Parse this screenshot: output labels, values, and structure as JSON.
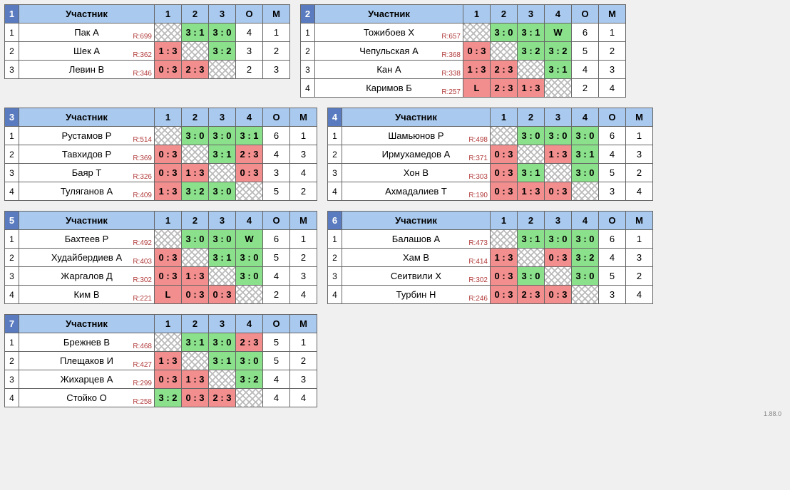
{
  "labels": {
    "participant": "Участник",
    "points": "О",
    "place": "М",
    "rating_prefix": "R:"
  },
  "version": "1.88.0",
  "groups": [
    {
      "number": 1,
      "name_width": 190,
      "rounds": 3,
      "players": [
        {
          "seed": 1,
          "name": "Пак А",
          "rating": 699,
          "results": [
            null,
            {
              "s": "3 : 1",
              "w": true
            },
            {
              "s": "3 : 0",
              "w": true
            }
          ],
          "pts": 4,
          "place": 1
        },
        {
          "seed": 2,
          "name": "Шек А",
          "rating": 362,
          "results": [
            {
              "s": "1 : 3",
              "w": false
            },
            null,
            {
              "s": "3 : 2",
              "w": true
            }
          ],
          "pts": 3,
          "place": 2
        },
        {
          "seed": 3,
          "name": "Левин В",
          "rating": 346,
          "results": [
            {
              "s": "0 : 3",
              "w": false
            },
            {
              "s": "2 : 3",
              "w": false
            },
            null
          ],
          "pts": 2,
          "place": 3
        }
      ]
    },
    {
      "number": 2,
      "name_width": 208,
      "rounds": 4,
      "players": [
        {
          "seed": 1,
          "name": "Тожибоев Х",
          "rating": 657,
          "results": [
            null,
            {
              "s": "3 : 0",
              "w": true
            },
            {
              "s": "3 : 1",
              "w": true
            },
            {
              "s": "W",
              "w": true
            }
          ],
          "pts": 6,
          "place": 1
        },
        {
          "seed": 2,
          "name": "Чепульская А",
          "rating": 368,
          "results": [
            {
              "s": "0 : 3",
              "w": false
            },
            null,
            {
              "s": "3 : 2",
              "w": true
            },
            {
              "s": "3 : 2",
              "w": true
            }
          ],
          "pts": 5,
          "place": 2
        },
        {
          "seed": 3,
          "name": "Кан А",
          "rating": 338,
          "results": [
            {
              "s": "1 : 3",
              "w": false
            },
            {
              "s": "2 : 3",
              "w": false
            },
            null,
            {
              "s": "3 : 1",
              "w": true
            }
          ],
          "pts": 4,
          "place": 3
        },
        {
          "seed": 4,
          "name": "Каримов Б",
          "rating": 257,
          "results": [
            {
              "s": "L",
              "w": false
            },
            {
              "s": "2 : 3",
              "w": false
            },
            {
              "s": "1 : 3",
              "w": false
            },
            null
          ],
          "pts": 2,
          "place": 4
        }
      ]
    },
    {
      "number": 3,
      "name_width": 190,
      "rounds": 4,
      "players": [
        {
          "seed": 1,
          "name": "Рустамов Р",
          "rating": 514,
          "results": [
            null,
            {
              "s": "3 : 0",
              "w": true
            },
            {
              "s": "3 : 0",
              "w": true
            },
            {
              "s": "3 : 1",
              "w": true
            }
          ],
          "pts": 6,
          "place": 1
        },
        {
          "seed": 2,
          "name": "Тавхидов Р",
          "rating": 369,
          "results": [
            {
              "s": "0 : 3",
              "w": false
            },
            null,
            {
              "s": "3 : 1",
              "w": true
            },
            {
              "s": "2 : 3",
              "w": false
            }
          ],
          "pts": 4,
          "place": 3
        },
        {
          "seed": 3,
          "name": "Баяр Т",
          "rating": 326,
          "results": [
            {
              "s": "0 : 3",
              "w": false
            },
            {
              "s": "1 : 3",
              "w": false
            },
            null,
            {
              "s": "0 : 3",
              "w": false
            }
          ],
          "pts": 3,
          "place": 4
        },
        {
          "seed": 4,
          "name": "Туляганов А",
          "rating": 409,
          "results": [
            {
              "s": "1 : 3",
              "w": false
            },
            {
              "s": "3 : 2",
              "w": true
            },
            {
              "s": "3 : 0",
              "w": true
            },
            null
          ],
          "pts": 5,
          "place": 2
        }
      ]
    },
    {
      "number": 4,
      "name_width": 208,
      "rounds": 4,
      "players": [
        {
          "seed": 1,
          "name": "Шамьюнов Р",
          "rating": 498,
          "results": [
            null,
            {
              "s": "3 : 0",
              "w": true
            },
            {
              "s": "3 : 0",
              "w": true
            },
            {
              "s": "3 : 0",
              "w": true
            }
          ],
          "pts": 6,
          "place": 1
        },
        {
          "seed": 2,
          "name": "Ирмухамедов А",
          "rating": 371,
          "results": [
            {
              "s": "0 : 3",
              "w": false
            },
            null,
            {
              "s": "1 : 3",
              "w": false
            },
            {
              "s": "3 : 1",
              "w": true
            }
          ],
          "pts": 4,
          "place": 3
        },
        {
          "seed": 3,
          "name": "Хон В",
          "rating": 303,
          "results": [
            {
              "s": "0 : 3",
              "w": false
            },
            {
              "s": "3 : 1",
              "w": true
            },
            null,
            {
              "s": "3 : 0",
              "w": true
            }
          ],
          "pts": 5,
          "place": 2
        },
        {
          "seed": 4,
          "name": "Ахмадалиев Т",
          "rating": 190,
          "results": [
            {
              "s": "0 : 3",
              "w": false
            },
            {
              "s": "1 : 3",
              "w": false
            },
            {
              "s": "0 : 3",
              "w": false
            },
            null
          ],
          "pts": 3,
          "place": 4
        }
      ]
    },
    {
      "number": 5,
      "name_width": 190,
      "rounds": 4,
      "players": [
        {
          "seed": 1,
          "name": "Бахтеев Р",
          "rating": 492,
          "results": [
            null,
            {
              "s": "3 : 0",
              "w": true
            },
            {
              "s": "3 : 0",
              "w": true
            },
            {
              "s": "W",
              "w": true
            }
          ],
          "pts": 6,
          "place": 1
        },
        {
          "seed": 2,
          "name": "Худайбердиев А",
          "rating": 403,
          "results": [
            {
              "s": "0 : 3",
              "w": false
            },
            null,
            {
              "s": "3 : 1",
              "w": true
            },
            {
              "s": "3 : 0",
              "w": true
            }
          ],
          "pts": 5,
          "place": 2
        },
        {
          "seed": 3,
          "name": "Жаргалов Д",
          "rating": 302,
          "results": [
            {
              "s": "0 : 3",
              "w": false
            },
            {
              "s": "1 : 3",
              "w": false
            },
            null,
            {
              "s": "3 : 0",
              "w": true
            }
          ],
          "pts": 4,
          "place": 3
        },
        {
          "seed": 4,
          "name": "Ким В",
          "rating": 221,
          "results": [
            {
              "s": "L",
              "w": false
            },
            {
              "s": "0 : 3",
              "w": false
            },
            {
              "s": "0 : 3",
              "w": false
            },
            null
          ],
          "pts": 2,
          "place": 4
        }
      ]
    },
    {
      "number": 6,
      "name_width": 208,
      "rounds": 4,
      "players": [
        {
          "seed": 1,
          "name": "Балашов А",
          "rating": 473,
          "results": [
            null,
            {
              "s": "3 : 1",
              "w": true
            },
            {
              "s": "3 : 0",
              "w": true
            },
            {
              "s": "3 : 0",
              "w": true
            }
          ],
          "pts": 6,
          "place": 1
        },
        {
          "seed": 2,
          "name": "Хам В",
          "rating": 414,
          "results": [
            {
              "s": "1 : 3",
              "w": false
            },
            null,
            {
              "s": "0 : 3",
              "w": false
            },
            {
              "s": "3 : 2",
              "w": true
            }
          ],
          "pts": 4,
          "place": 3
        },
        {
          "seed": 3,
          "name": "Сеитвили Х",
          "rating": 302,
          "results": [
            {
              "s": "0 : 3",
              "w": false
            },
            {
              "s": "3 : 0",
              "w": true
            },
            null,
            {
              "s": "3 : 0",
              "w": true
            }
          ],
          "pts": 5,
          "place": 2
        },
        {
          "seed": 4,
          "name": "Турбин Н",
          "rating": 246,
          "results": [
            {
              "s": "0 : 3",
              "w": false
            },
            {
              "s": "2 : 3",
              "w": false
            },
            {
              "s": "0 : 3",
              "w": false
            },
            null
          ],
          "pts": 3,
          "place": 4
        }
      ]
    },
    {
      "number": 7,
      "name_width": 190,
      "rounds": 4,
      "players": [
        {
          "seed": 1,
          "name": "Брежнев В",
          "rating": 468,
          "results": [
            null,
            {
              "s": "3 : 1",
              "w": true
            },
            {
              "s": "3 : 0",
              "w": true
            },
            {
              "s": "2 : 3",
              "w": false
            }
          ],
          "pts": 5,
          "place": 1
        },
        {
          "seed": 2,
          "name": "Плещаков И",
          "rating": 427,
          "results": [
            {
              "s": "1 : 3",
              "w": false
            },
            null,
            {
              "s": "3 : 1",
              "w": true
            },
            {
              "s": "3 : 0",
              "w": true
            }
          ],
          "pts": 5,
          "place": 2
        },
        {
          "seed": 3,
          "name": "Жихарцев А",
          "rating": 299,
          "results": [
            {
              "s": "0 : 3",
              "w": false
            },
            {
              "s": "1 : 3",
              "w": false
            },
            null,
            {
              "s": "3 : 2",
              "w": true
            }
          ],
          "pts": 4,
          "place": 3
        },
        {
          "seed": 4,
          "name": "Стойко О",
          "rating": 258,
          "results": [
            {
              "s": "3 : 2",
              "w": true
            },
            {
              "s": "0 : 3",
              "w": false
            },
            {
              "s": "2 : 3",
              "w": false
            },
            null
          ],
          "pts": 4,
          "place": 4
        }
      ]
    }
  ]
}
